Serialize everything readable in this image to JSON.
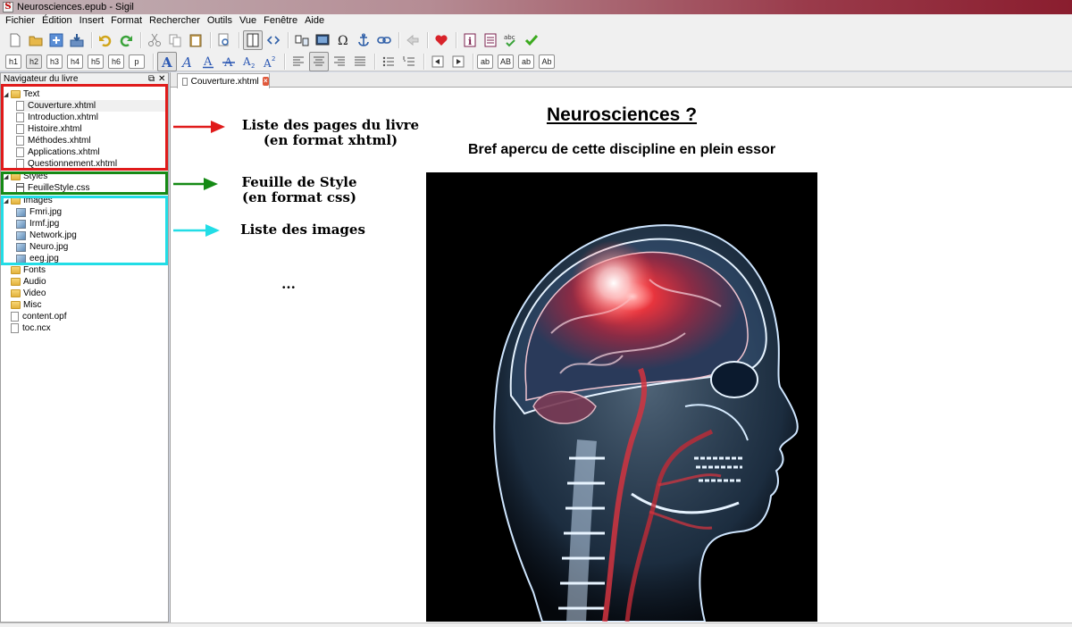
{
  "window": {
    "title": "Neurosciences.epub - Sigil",
    "app_icon_letter": "S"
  },
  "menu": [
    "Fichier",
    "Édition",
    "Insert",
    "Format",
    "Rechercher",
    "Outils",
    "Vue",
    "Fenêtre",
    "Aide"
  ],
  "toolbar2": {
    "heading_buttons": [
      "h1",
      "h2",
      "h3",
      "h4",
      "h5",
      "h6",
      "p"
    ],
    "case_buttons": [
      "ab",
      "AB",
      "ab",
      "Ab"
    ]
  },
  "navigator": {
    "title": "Navigateur du livre",
    "text_folder": "Text",
    "text_files": [
      "Couverture.xhtml",
      "Introduction.xhtml",
      "Histoire.xhtml",
      "Méthodes.xhtml",
      "Applications.xhtml",
      "Questionnement.xhtml"
    ],
    "styles_folder": "Styles",
    "style_files": [
      "FeuilleStyle.css"
    ],
    "images_folder": "Images",
    "image_files": [
      "Fmri.jpg",
      "Irmf.jpg",
      "Network.jpg",
      "Neuro.jpg",
      "eeg.jpg"
    ],
    "other_folders": [
      "Fonts",
      "Audio",
      "Video",
      "Misc"
    ],
    "root_files": [
      "content.opf",
      "toc.ncx"
    ]
  },
  "editor": {
    "tab_label": "Couverture.xhtml",
    "page_title": "Neurosciences ?",
    "page_subtitle": "Bref apercu de cette discipline en plein essor"
  },
  "annotations": {
    "pages_line1": "Liste des pages du livre",
    "pages_line2": "(en format xhtml)",
    "style_line1": "Feuille de Style",
    "style_line2": "(en format css)",
    "images_line1": "Liste des images",
    "ellipsis": "..."
  },
  "colors": {
    "pages_annotation": "#e01b1b",
    "style_annotation": "#158a15",
    "images_annotation": "#22dde6"
  }
}
